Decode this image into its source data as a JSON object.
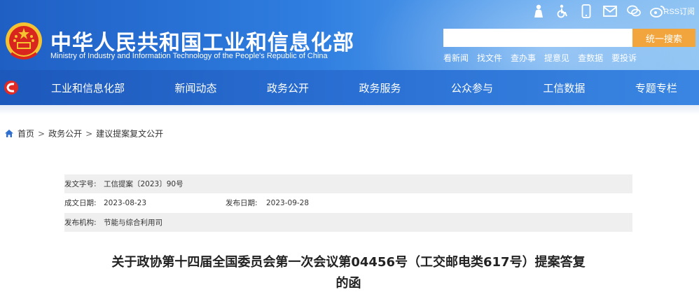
{
  "header": {
    "title": "中华人民共和国工业和信息化部",
    "subtitle": "Ministry of Industry and Information Technology of the People's Republic of China",
    "rss_label": "RSS订阅",
    "icons": [
      "accessibility-elder-icon",
      "wheelchair-icon",
      "mobile-icon",
      "mail-icon",
      "wechat-icon",
      "weibo-icon"
    ]
  },
  "search": {
    "placeholder": "",
    "button_label": "统一搜索"
  },
  "quick_links": [
    "看新闻",
    "找文件",
    "查办事",
    "提意见",
    "查数据",
    "要投诉"
  ],
  "nav": {
    "items": [
      "工业和信息化部",
      "新闻动态",
      "政务公开",
      "政务服务",
      "公众参与",
      "工信数据",
      "专题专栏"
    ]
  },
  "breadcrumb": {
    "items": [
      "首页",
      "政务公开",
      "建议提案复文公开"
    ],
    "separator": ">"
  },
  "meta": {
    "doc_number_label": "发文字号:",
    "doc_number": "工信提案〔2023〕90号",
    "written_date_label": "成文日期:",
    "written_date": "2023-08-23",
    "publish_date_label": "发布日期:",
    "publish_date": "2023-09-28",
    "agency_label": "发布机构:",
    "agency": "节能与综合利用司"
  },
  "document": {
    "title_line1": "关于政协第十四届全国委员会第一次会议第04456号（工交邮电类617号）提案答复",
    "title_line2": "的函"
  },
  "colors": {
    "header_blue": "#2f7ee0",
    "nav_blue": "#2a6fd3",
    "search_button": "#f3a53d",
    "meta_shade": "#efefef"
  }
}
